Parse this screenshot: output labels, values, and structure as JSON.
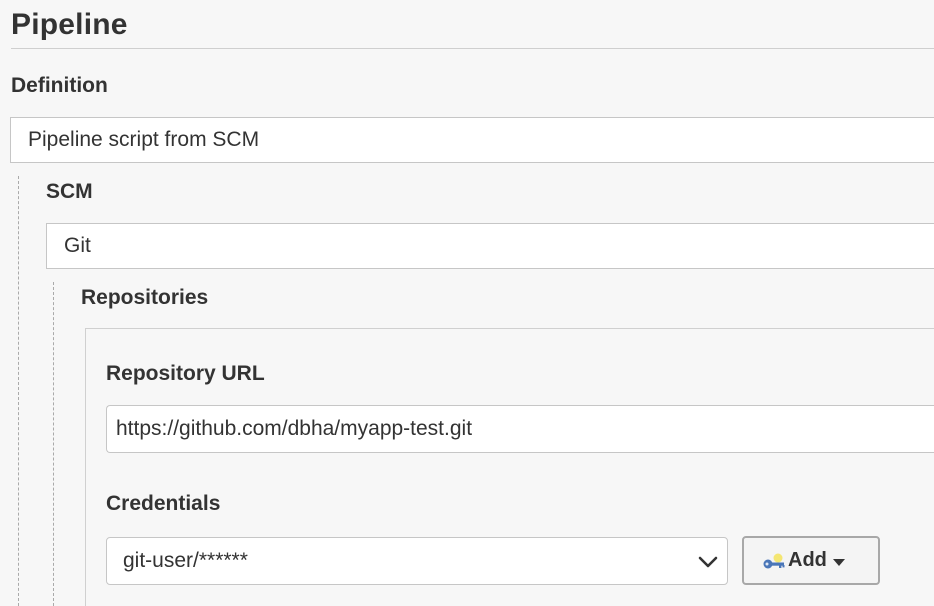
{
  "section": {
    "title": "Pipeline"
  },
  "definition": {
    "label": "Definition",
    "selected": "Pipeline script from SCM"
  },
  "scm": {
    "label": "SCM",
    "selected": "Git"
  },
  "repositories": {
    "label": "Repositories",
    "url_label": "Repository URL",
    "url_value": "https://github.com/dbha/myapp-test.git",
    "credentials_label": "Credentials",
    "credentials_selected": "git-user/******",
    "add_button_label": "Add"
  },
  "icons": {
    "credentials_dropdown": "chevron-down-icon",
    "add_key": "key-icon",
    "add_caret": "caret-down-icon"
  },
  "colors": {
    "background": "#f7f7f7",
    "input_background": "#ffffff",
    "border": "#c6c6c6",
    "text": "#333333"
  }
}
